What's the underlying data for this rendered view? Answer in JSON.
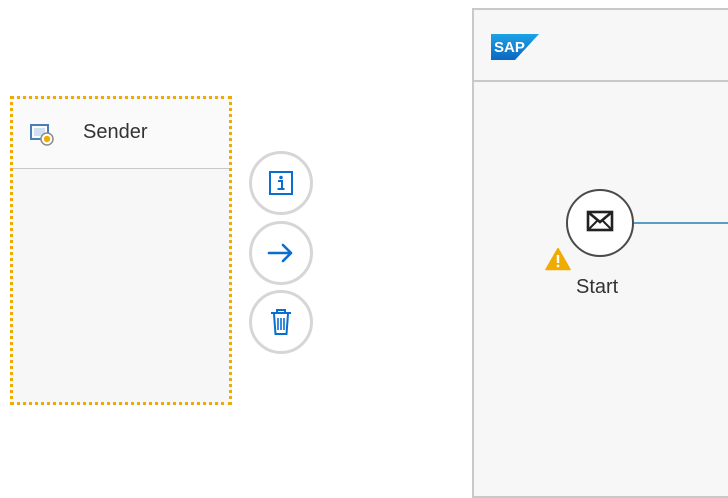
{
  "sender": {
    "label": "Sender",
    "icon": "sender-system-icon",
    "border_color": "#f0ab00"
  },
  "actions": [
    {
      "name": "info",
      "icon": "info-icon",
      "color": "#0a6ed1"
    },
    {
      "name": "connect",
      "icon": "arrow-right-icon",
      "color": "#0a6ed1"
    },
    {
      "name": "delete",
      "icon": "trash-icon",
      "color": "#0a6ed1"
    }
  ],
  "pool": {
    "logo": "SAP",
    "start_event": {
      "label": "Start",
      "icon": "envelope-icon",
      "warning_icon": "warning-icon",
      "warning_color": "#f0ab00"
    },
    "flow_color": "#5b9bc4"
  }
}
